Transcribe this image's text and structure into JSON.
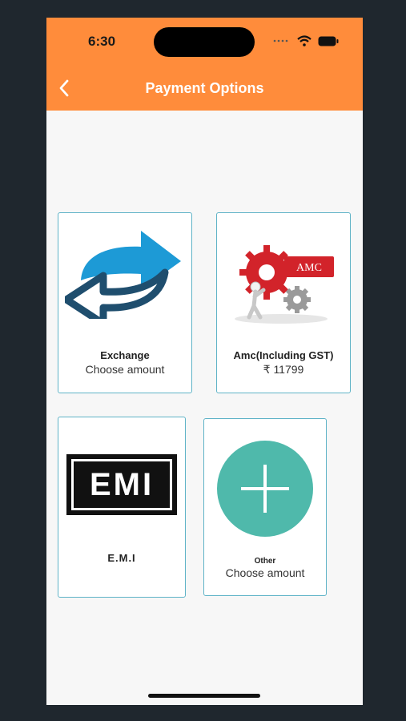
{
  "status_bar": {
    "time": "6:30"
  },
  "header": {
    "title": "Payment Options"
  },
  "options": [
    {
      "title": "Exchange",
      "subtitle": "Choose amount",
      "icon": "exchange-arrows-icon"
    },
    {
      "title": "Amc(Including GST)",
      "subtitle": "₹ 11799",
      "icon": "amc-gears-icon",
      "badge": "AMC"
    },
    {
      "title": "E.M.I",
      "icon": "emi-logo",
      "logo_text": "EMI"
    },
    {
      "title": "Other",
      "subtitle": "Choose amount",
      "icon": "plus-circle-icon"
    }
  ],
  "colors": {
    "header": "#ff8c3b",
    "card_border": "#5fb3c7",
    "plus_circle": "#4fb9ab",
    "arrow_blue": "#1d9ad6",
    "arrow_dark": "#1f4e6e"
  }
}
